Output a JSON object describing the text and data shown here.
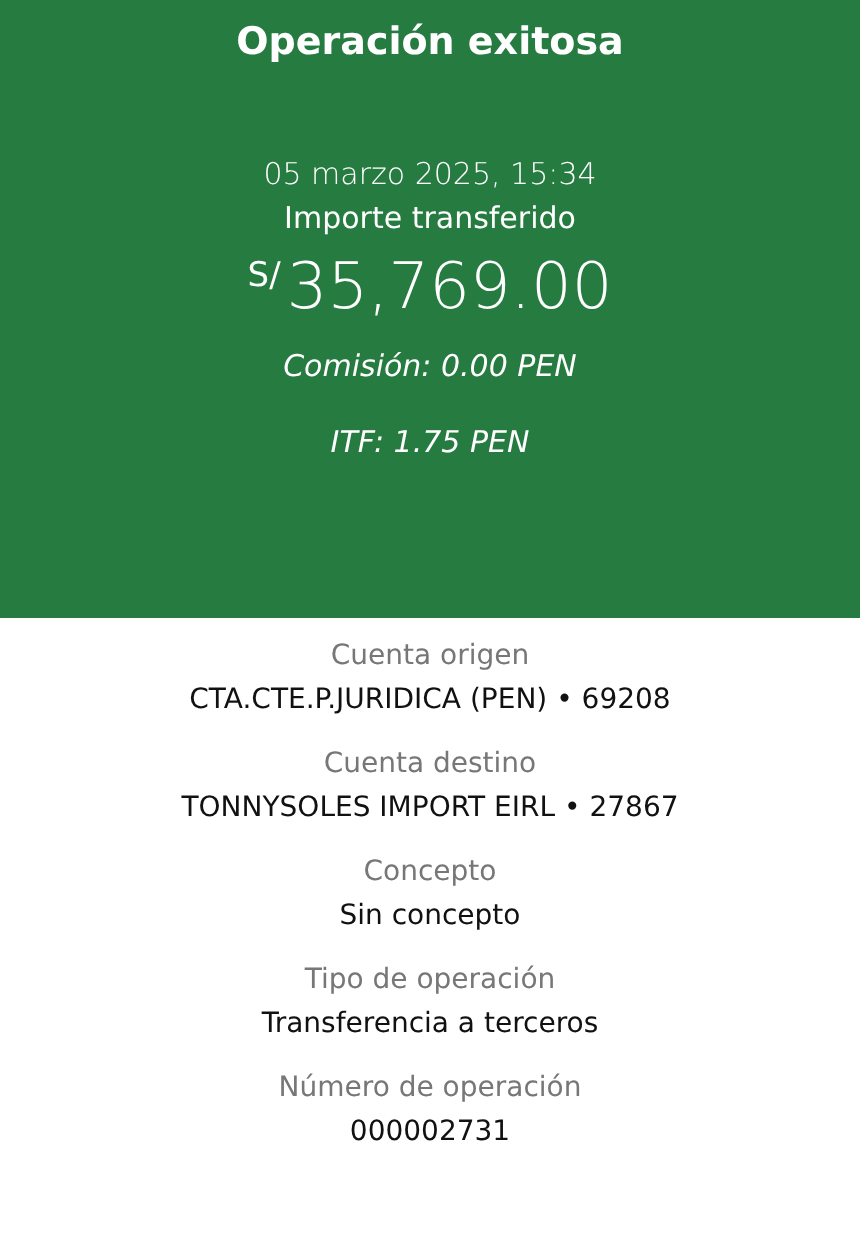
{
  "header": {
    "title": "Operación exitosa",
    "datetime": "05 marzo 2025, 15:34",
    "amount_label": "Importe transferido",
    "currency": "S/",
    "amount": "35,769.00",
    "commission": "Comisión: 0.00 PEN",
    "itf": "ITF: 1.75 PEN"
  },
  "details": [
    {
      "label": "Cuenta origen",
      "value": "CTA.CTE.P.JURIDICA (PEN) • 69208"
    },
    {
      "label": "Cuenta destino",
      "value": "TONNYSOLES IMPORT EIRL • 27867"
    },
    {
      "label": "Concepto",
      "value": "Sin concepto"
    },
    {
      "label": "Tipo de operación",
      "value": "Transferencia a terceros"
    },
    {
      "label": "Número de operación",
      "value": "000002731"
    }
  ]
}
